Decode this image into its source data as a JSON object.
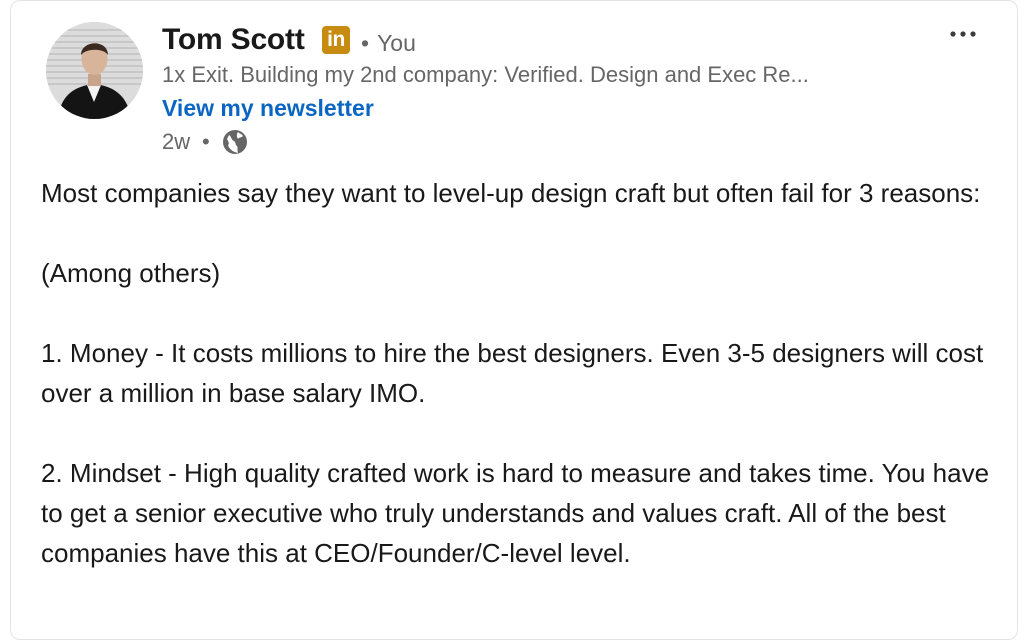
{
  "post": {
    "author": {
      "name": "Tom Scott",
      "badge": "in",
      "relation": "You",
      "headline": "1x Exit. Building my 2nd company: Verified. Design and Exec Re...",
      "newsletter_link": "View my newsletter",
      "time": "2w",
      "visibility_icon": "globe-icon"
    },
    "menu_icon": "ellipsis-icon",
    "body": {
      "p1": "Most companies say they want to level-up design craft but often fail for 3 reasons:",
      "p2": "(Among others)",
      "p3": "1. Money - It costs millions to hire the best designers. Even 3-5 designers will cost over a million in base salary IMO.",
      "p4": "2. Mindset - High quality crafted work is hard to measure and takes time. You have to get a senior executive who truly understands and values craft. All of the best companies have this at CEO/Founder/C-level level."
    }
  },
  "colors": {
    "link": "#0a66c2",
    "badge": "#c78b0f",
    "text": "#191919",
    "muted": "#666666"
  }
}
